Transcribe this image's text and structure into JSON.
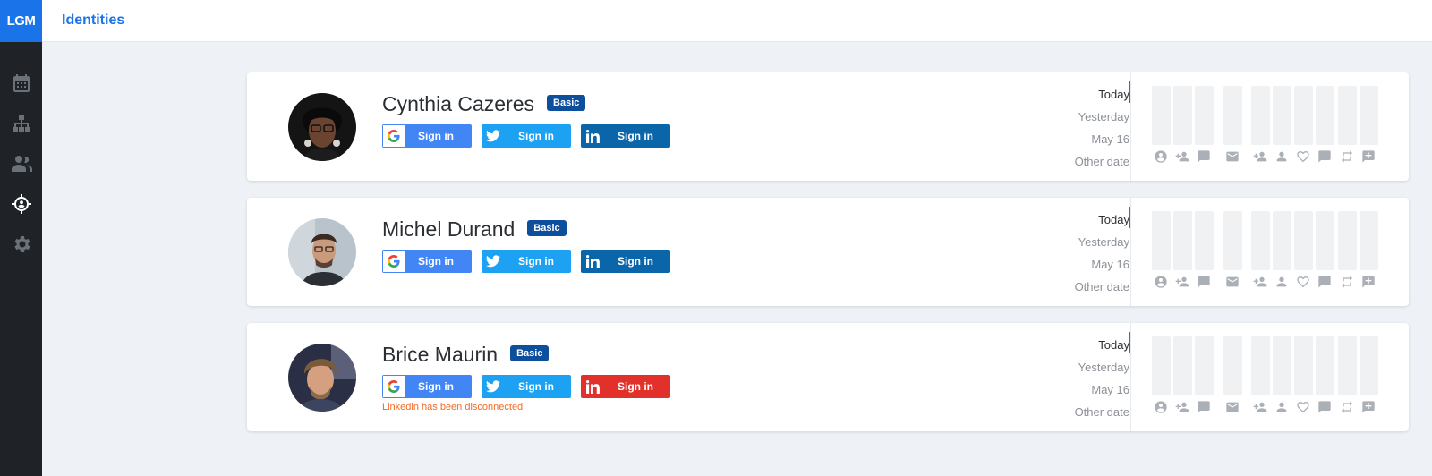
{
  "app": {
    "logo": "LGM",
    "page_title": "Identities"
  },
  "sidebar": {
    "items": [
      {
        "name": "calendar-icon",
        "active": false
      },
      {
        "name": "sitemap-icon",
        "active": false
      },
      {
        "name": "users-icon",
        "active": false
      },
      {
        "name": "identity-target-icon",
        "active": true
      },
      {
        "name": "gear-icon",
        "active": false
      }
    ]
  },
  "date_options": [
    "Today",
    "Yesterday",
    "May 16",
    "Other date"
  ],
  "stat_icons": [
    "profile-icon",
    "add-person-icon",
    "comment-icon",
    "mail-icon",
    "add-person-icon",
    "person-icon",
    "heart-icon",
    "comment-icon",
    "retweet-icon",
    "add-comment-icon"
  ],
  "colors": {
    "accent": "#1a73e8",
    "badge": "#0d4f9c",
    "google": "#4285f4",
    "twitter": "#1da1f2",
    "linkedin": "#0a66a8",
    "linkedin_error": "#e2312b",
    "warning_text": "#f26b21"
  },
  "identities": [
    {
      "name": "Cynthia Cazeres",
      "plan": "Basic",
      "buttons": {
        "google": "Sign in",
        "twitter": "Sign in",
        "linkedin": "Sign in"
      },
      "linkedin_status": "connected",
      "warning": "",
      "selected_date": "Today"
    },
    {
      "name": "Michel Durand",
      "plan": "Basic",
      "buttons": {
        "google": "Sign in",
        "twitter": "Sign in",
        "linkedin": "Sign in"
      },
      "linkedin_status": "connected",
      "warning": "",
      "selected_date": "Today"
    },
    {
      "name": "Brice Maurin",
      "plan": "Basic",
      "buttons": {
        "google": "Sign in",
        "twitter": "Sign in",
        "linkedin": "Sign in"
      },
      "linkedin_status": "disconnected",
      "warning": "Linkedin has been disconnected",
      "selected_date": "Today"
    }
  ]
}
